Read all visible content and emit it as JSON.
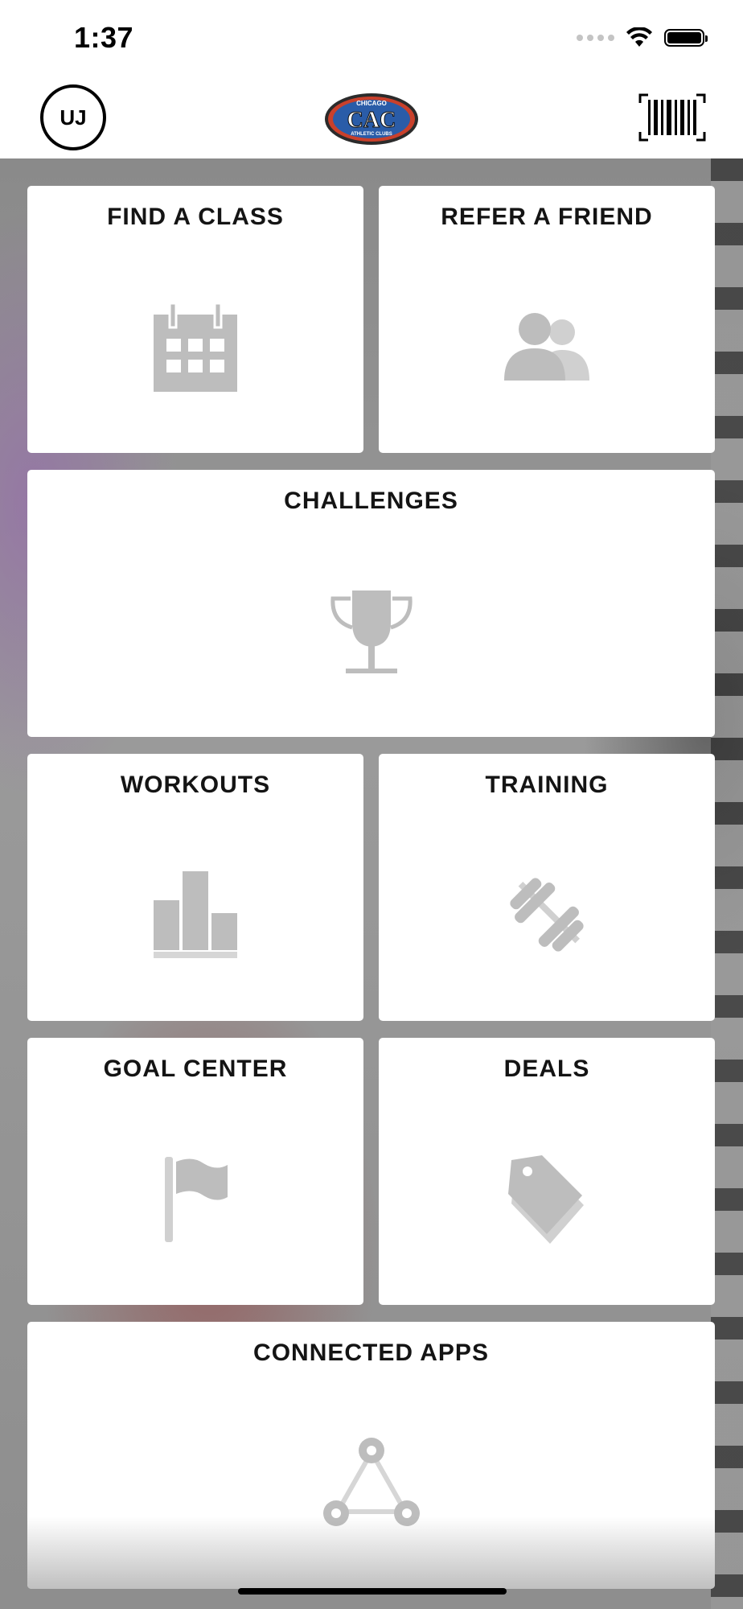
{
  "status_bar": {
    "time": "1:37"
  },
  "header": {
    "avatar_initials": "UJ",
    "logo": {
      "line1": "CHICAGO",
      "main": "CAC",
      "line2": "ATHLETIC CLUBS"
    }
  },
  "tiles": [
    {
      "label": "FIND A CLASS",
      "icon": "calendar-icon"
    },
    {
      "label": "REFER A FRIEND",
      "icon": "users-icon"
    },
    {
      "label": "CHALLENGES",
      "icon": "trophy-icon"
    },
    {
      "label": "WORKOUTS",
      "icon": "bar-chart-icon"
    },
    {
      "label": "TRAINING",
      "icon": "dumbbell-icon"
    },
    {
      "label": "GOAL CENTER",
      "icon": "flag-icon"
    },
    {
      "label": "DEALS",
      "icon": "price-tag-icon"
    },
    {
      "label": "CONNECTED APPS",
      "icon": "network-icon"
    }
  ],
  "colors": {
    "icon_gray": "#bdbdbd",
    "tile_bg": "#ffffff",
    "logo_blue": "#2a5ca8",
    "logo_red": "#c9402b"
  }
}
